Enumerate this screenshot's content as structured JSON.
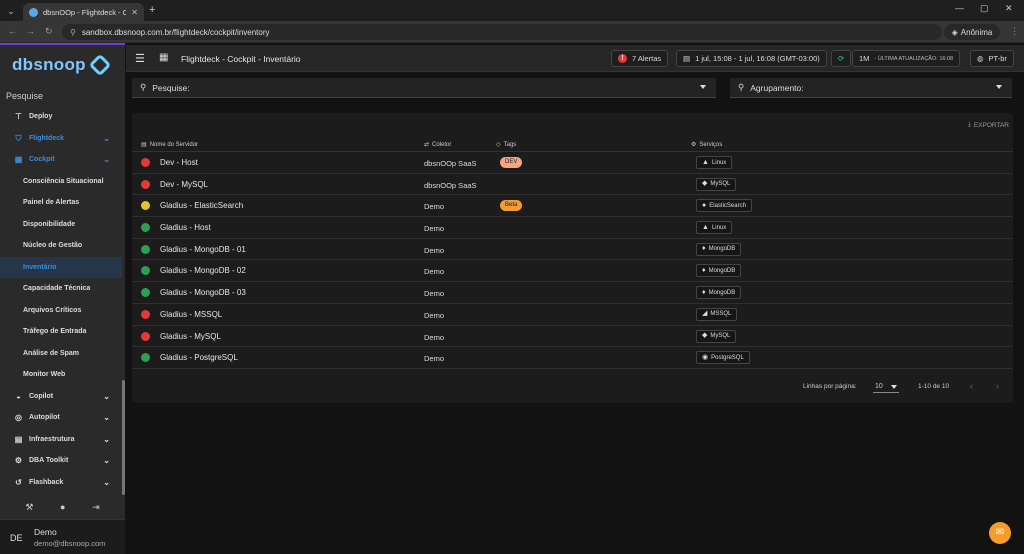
{
  "browser": {
    "tab_title": "dbsnOOp - Flightdeck - Cockpit",
    "url": "sandbox.dbsnoop.com.br/flightdeck/cockpit/inventory",
    "incognito_label": "Anônima"
  },
  "sidebar": {
    "logo": "dbsnoop",
    "search_label": "Pesquise",
    "items": [
      {
        "label": "Deploy",
        "icon": "deploy-icon",
        "level": "top",
        "state": "normal"
      },
      {
        "label": "Flightdeck",
        "icon": "shield-icon",
        "level": "top",
        "state": "blue",
        "chevron": true
      },
      {
        "label": "Cockpit",
        "icon": "grid-icon",
        "level": "top",
        "state": "blue",
        "chevron": true
      },
      {
        "label": "Consciência Situacional",
        "level": "sub",
        "state": "normal"
      },
      {
        "label": "Painel de Alertas",
        "level": "sub",
        "state": "normal"
      },
      {
        "label": "Disponibilidade",
        "level": "sub",
        "state": "normal"
      },
      {
        "label": "Núcleo de Gestão",
        "level": "sub",
        "state": "normal"
      },
      {
        "label": "Inventário",
        "level": "sub",
        "state": "active"
      },
      {
        "label": "Capacidade Técnica",
        "level": "sub",
        "state": "normal"
      },
      {
        "label": "Arquivos Críticos",
        "level": "sub",
        "state": "normal"
      },
      {
        "label": "Tráfego de Entrada",
        "level": "sub",
        "state": "normal"
      },
      {
        "label": "Análise de Spam",
        "level": "sub",
        "state": "normal"
      },
      {
        "label": "Monitor Web",
        "level": "sub",
        "state": "normal"
      },
      {
        "label": "Copilot",
        "icon": "copilot-icon",
        "level": "top",
        "state": "normal",
        "chevron": true
      },
      {
        "label": "Autopilot",
        "icon": "autopilot-icon",
        "level": "top",
        "state": "normal",
        "chevron": true
      },
      {
        "label": "Infraestrutura",
        "icon": "infra-icon",
        "level": "top",
        "state": "normal",
        "chevron": true
      },
      {
        "label": "DBA Toolkit",
        "icon": "toolkit-icon",
        "level": "top",
        "state": "normal",
        "chevron": true
      },
      {
        "label": "Flashback",
        "icon": "history-icon",
        "level": "top",
        "state": "normal",
        "chevron": true
      }
    ],
    "user": {
      "initials": "DE",
      "name": "Demo",
      "email": "demo@dbsnoop.com"
    }
  },
  "header": {
    "title": "Flightdeck - Cockpit - Inventário",
    "alerts": "7 Alertas",
    "date_range": "1 jul, 15:08 - 1 jul, 16:08 (GMT-03:00)",
    "interval": "1M",
    "last_update": "- ÚLTIMA ATUALIZAÇÃO: 16:08",
    "language": "PT-br"
  },
  "filters": {
    "search": "Pesquise:",
    "grouping": "Agrupamento:"
  },
  "table": {
    "export_label": "EXPORTAR",
    "headers": {
      "server": "Nome do Servidor",
      "collector": "Coletor",
      "tags": "Tags",
      "services": "Serviços"
    },
    "rows": [
      {
        "name": "Dev - Host",
        "status": "#e53935",
        "collector": "dbsnOOp SaaS",
        "tag": "DEV",
        "tag_color": "#f4a582",
        "service": "Linux",
        "service_icon": "▲"
      },
      {
        "name": "Dev - MySQL",
        "status": "#e53935",
        "collector": "dbsnOOp SaaS",
        "tag": "",
        "tag_color": "",
        "service": "MySQL",
        "service_icon": "◆"
      },
      {
        "name": "Gladius - ElasticSearch",
        "status": "#e6c229",
        "collector": "Demo",
        "tag": "Beta",
        "tag_color": "#f39c33",
        "service": "ElasticSearch",
        "service_icon": "●"
      },
      {
        "name": "Gladius - Host",
        "status": "#2e9e4f",
        "collector": "Demo",
        "tag": "",
        "tag_color": "",
        "service": "Linux",
        "service_icon": "▲"
      },
      {
        "name": "Gladius - MongoDB - 01",
        "status": "#2e9e4f",
        "collector": "Demo",
        "tag": "",
        "tag_color": "",
        "service": "MongoDB",
        "service_icon": "♦"
      },
      {
        "name": "Gladius - MongoDB - 02",
        "status": "#2e9e4f",
        "collector": "Demo",
        "tag": "",
        "tag_color": "",
        "service": "MongoDB",
        "service_icon": "♦"
      },
      {
        "name": "Gladius - MongoDB - 03",
        "status": "#2e9e4f",
        "collector": "Demo",
        "tag": "",
        "tag_color": "",
        "service": "MongoDB",
        "service_icon": "♦"
      },
      {
        "name": "Gladius - MSSQL",
        "status": "#e53935",
        "collector": "Demo",
        "tag": "",
        "tag_color": "",
        "service": "MSSQL",
        "service_icon": "◢"
      },
      {
        "name": "Gladius - MySQL",
        "status": "#e53935",
        "collector": "Demo",
        "tag": "",
        "tag_color": "",
        "service": "MySQL",
        "service_icon": "◆"
      },
      {
        "name": "Gladius - PostgreSQL",
        "status": "#2e9e4f",
        "collector": "Demo",
        "tag": "",
        "tag_color": "",
        "service": "PostgreSQL",
        "service_icon": "◉"
      }
    ],
    "pager": {
      "rows_label": "Linhas por página:",
      "page_size": "10",
      "range": "1-10 de 10"
    }
  },
  "colors": {
    "accent": "#3b8cd9",
    "fab": "#f59d2a"
  }
}
